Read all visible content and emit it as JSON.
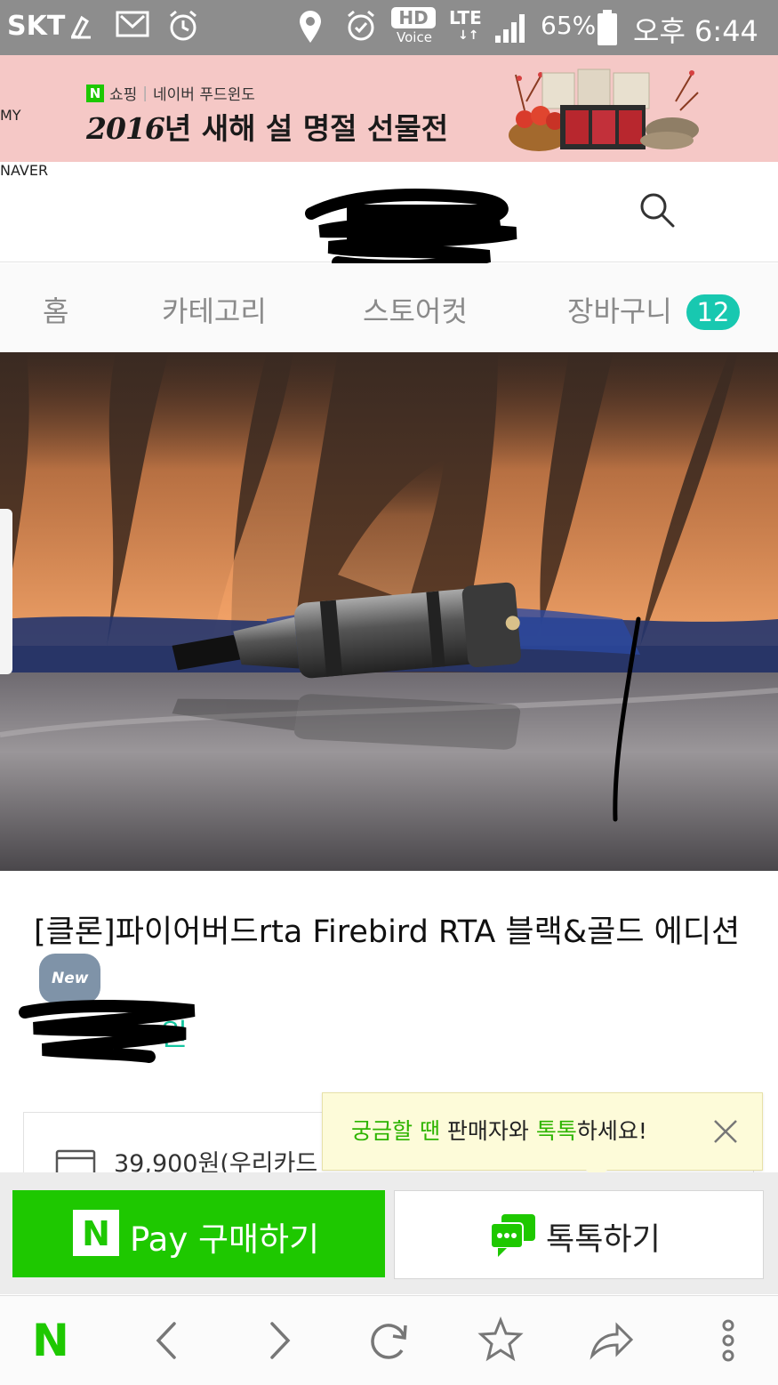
{
  "status_bar": {
    "carrier": "SKT",
    "network_hd": "HD",
    "network_voice": "Voice",
    "network_lte": "LTE",
    "battery": "65%",
    "time": "오후 6:44"
  },
  "banner": {
    "brand_tag": "쇼핑",
    "brand_sep": "|",
    "brand_sub": "네이버 푸드윈도",
    "year": "2016",
    "headline": "년 새해 설 명절 선물전",
    "n_letter": "N"
  },
  "header": {
    "logo": "NAVER",
    "my_label": "MY"
  },
  "tabs": [
    {
      "label": "홈"
    },
    {
      "label": "카테고리"
    },
    {
      "label": "스토어컷"
    },
    {
      "label": "장바구니"
    }
  ],
  "cart_count": "12",
  "product": {
    "title": "[클론]파이어버드rta Firebird RTA 블랙&골드 에디션",
    "badge": "New",
    "price_suffix": "원",
    "card_price": "39,900원(우리카드"
  },
  "tooltip": {
    "part1": "궁금할 땐",
    "part2": "판매자와",
    "part3": "톡톡",
    "part4": "하세요!"
  },
  "actions": {
    "pay_n": "N",
    "pay_label": "Pay 구매하기",
    "talk_label": "톡톡하기"
  },
  "browser_bar": {
    "home_logo": "N"
  },
  "colors": {
    "naver_green": "#1ec800",
    "teal_badge": "#18c8b0",
    "price_teal": "#14c6a0",
    "banner_pink": "#f5c8c6",
    "status_gray": "#8d8d8d"
  }
}
